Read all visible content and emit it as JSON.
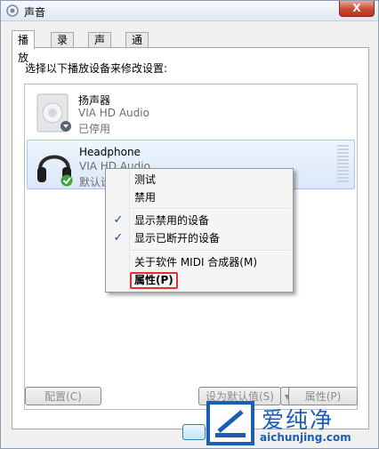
{
  "window": {
    "title": "声音",
    "close_label": "X"
  },
  "tabs": [
    {
      "label": "播放"
    },
    {
      "label": "录制"
    },
    {
      "label": "声音"
    },
    {
      "label": "通信"
    }
  ],
  "instructions": "选择以下播放设备来修改设置:",
  "devices": [
    {
      "name": "扬声器",
      "driver": "VIA HD Audio",
      "status": "已停用",
      "icon": "speaker-icon",
      "badge": "down-arrow-badge"
    },
    {
      "name": "Headphone",
      "driver": "VIA HD Audio",
      "status": "默认设",
      "icon": "headphone-icon",
      "badge": "green-check-badge"
    }
  ],
  "context_menu": {
    "items": [
      {
        "label": "测试"
      },
      {
        "label": "禁用"
      },
      {
        "label": "显示禁用的设备",
        "checked": true
      },
      {
        "label": "显示已断开的设备",
        "checked": true
      },
      {
        "label": "关于软件 MIDI 合成器(M)"
      },
      {
        "label": "属性(P)",
        "highlighted": true
      }
    ],
    "check_glyph": "✓"
  },
  "buttons": {
    "configure": "配置(C)",
    "set_default": "设为默认值(S)",
    "properties": "属性(P)"
  },
  "watermark": {
    "text": "爱纯净",
    "url": "aichunjing.com"
  },
  "colors": {
    "accent": "#1a5fb4",
    "highlight_border": "#e03030",
    "selected_bg": "#dbe8f8"
  }
}
